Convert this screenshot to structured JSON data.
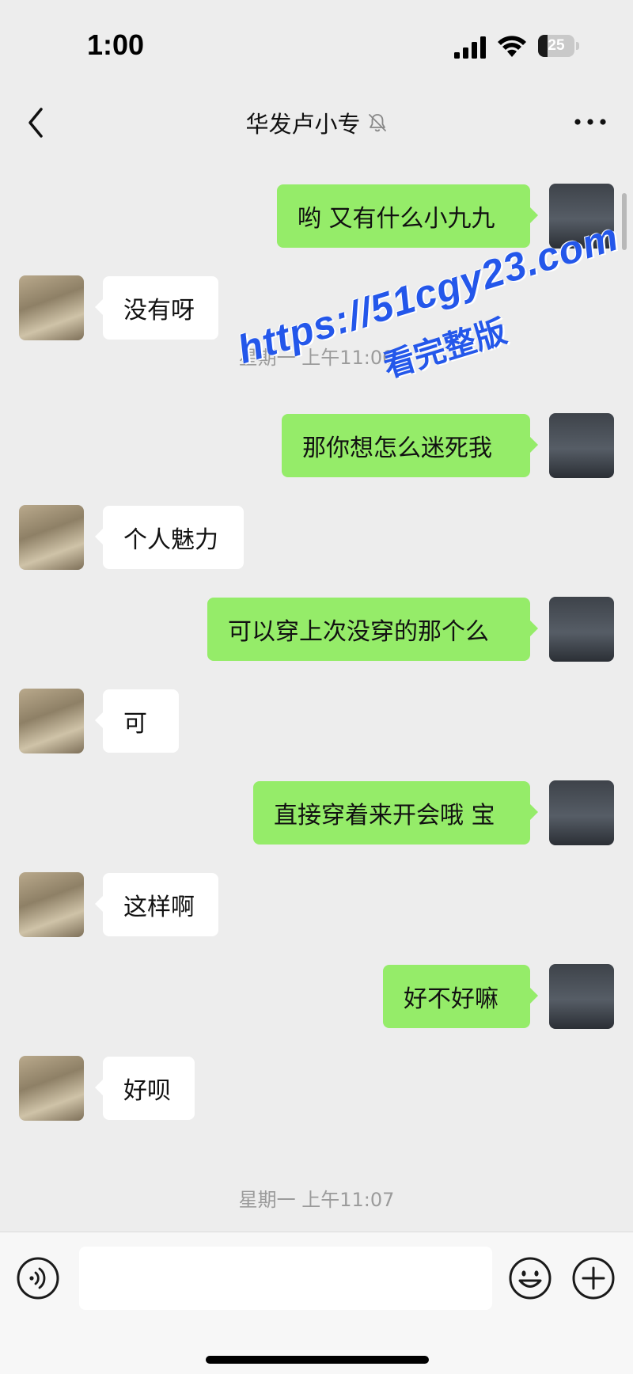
{
  "status_bar": {
    "time": "1:00",
    "battery_level": "25",
    "battery_fraction": 0.25,
    "icons": [
      "signal-icon",
      "wifi-icon",
      "battery-icon"
    ]
  },
  "header": {
    "title": "华发卢小专",
    "icons": [
      "chevron-left-icon",
      "mute-bell-icon",
      "more-icon"
    ]
  },
  "messages": [
    {
      "side": "self",
      "text": "哟 又有什么小九九"
    },
    {
      "side": "other",
      "text": "没有呀"
    },
    {
      "side": "self",
      "text": "那你想怎么迷死我"
    },
    {
      "side": "other",
      "text": "个人魅力"
    },
    {
      "side": "self",
      "text": "可以穿上次没穿的那个么"
    },
    {
      "side": "other",
      "text": "可"
    },
    {
      "side": "self",
      "text": "直接穿着来开会哦 宝"
    },
    {
      "side": "other",
      "text": "这样啊"
    },
    {
      "side": "self",
      "text": "好不好嘛"
    },
    {
      "side": "other",
      "text": "好呗"
    }
  ],
  "timestamps": [
    "星期一 上午11:00",
    "星期一 上午11:07"
  ],
  "watermark": {
    "url": "https://51cgy23.com",
    "sub": "看完整版"
  },
  "input_bar": {
    "value": "",
    "icons": [
      "voice-icon",
      "emoji-icon",
      "plus-icon"
    ]
  },
  "colors": {
    "background": "#ededed",
    "self_bubble": "#95ec69",
    "other_bubble": "#ffffff",
    "watermark": "#2457ea"
  }
}
